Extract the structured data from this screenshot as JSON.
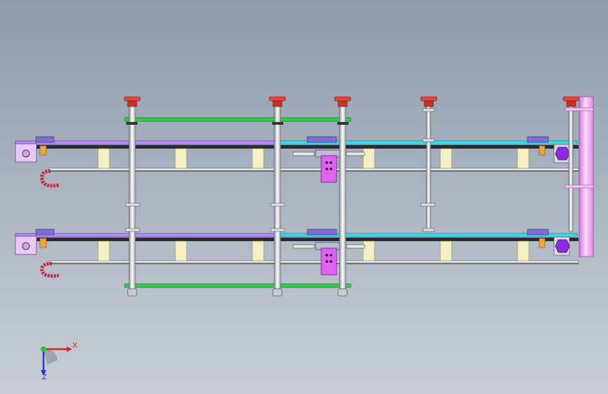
{
  "viewport": {
    "background_top": "#8f9bab",
    "background_bottom": "#c9ced6"
  },
  "colors": {
    "purple_rail": "#b68bff",
    "cyan_rail": "#38dcea",
    "green_plate": "#33d04a",
    "red_cap": "#e0453a",
    "magenta_carriage": "#e062f2",
    "pink_column": "#f1a6f4",
    "yellow_block": "#f4f0c4",
    "orange_block": "#f0a43a",
    "chain": "#c72a40"
  },
  "triad": {
    "x_label": "X",
    "z_label": "Z",
    "x_color": "#d7261b",
    "y_color": "#2ac638",
    "z_color": "#2434d0"
  }
}
